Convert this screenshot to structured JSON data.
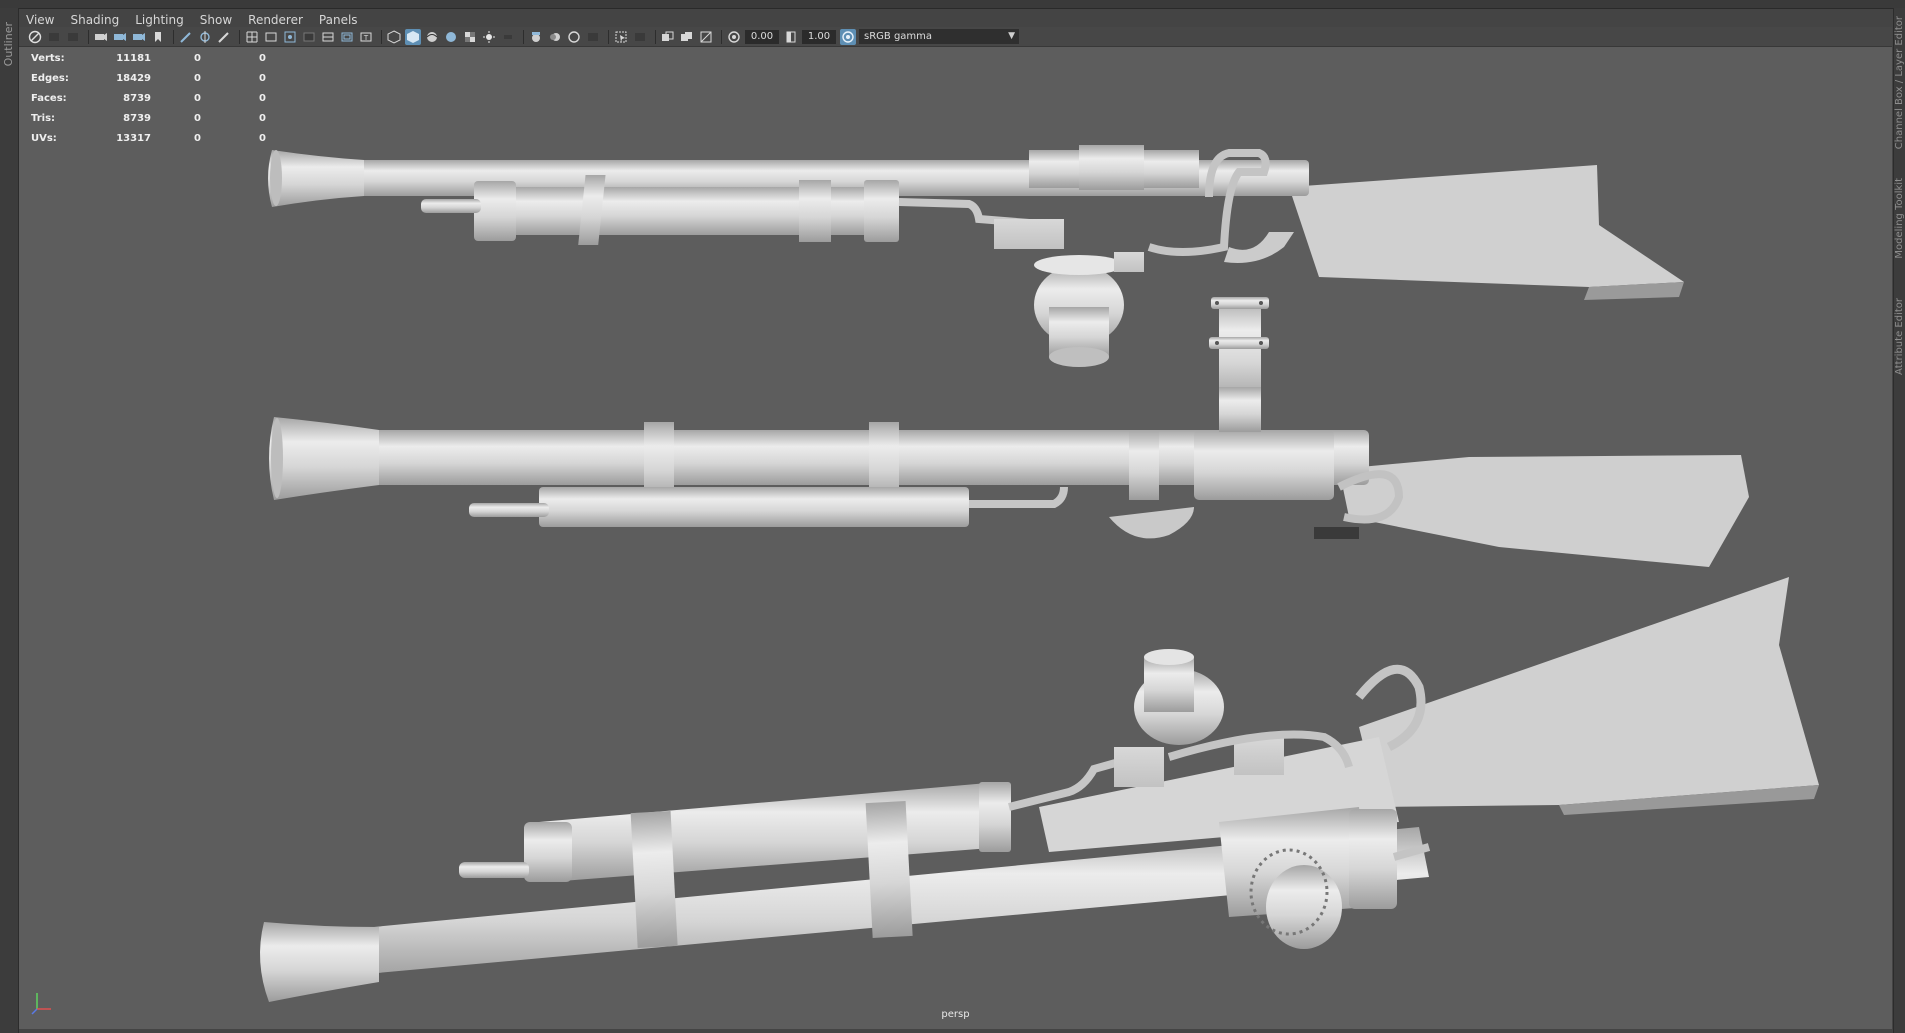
{
  "menu": [
    "View",
    "Shading",
    "Lighting",
    "Show",
    "Renderer",
    "Panels"
  ],
  "toolbar": {
    "exposure_value": "0.00",
    "gamma_value": "1.00",
    "color_space": "sRGB gamma"
  },
  "hud_stats": [
    {
      "label": "Verts:",
      "v1": "11181",
      "v2": "0",
      "v3": "0"
    },
    {
      "label": "Edges:",
      "v1": "18429",
      "v2": "0",
      "v3": "0"
    },
    {
      "label": "Faces:",
      "v1": "8739",
      "v2": "0",
      "v3": "0"
    },
    {
      "label": "Tris:",
      "v1": "8739",
      "v2": "0",
      "v3": "0"
    },
    {
      "label": "UVs:",
      "v1": "13317",
      "v2": "0",
      "v3": "0"
    }
  ],
  "camera": "persp",
  "side_panels": {
    "left": "Outliner",
    "right": [
      "Channel Box / Layer Editor",
      "Modeling Toolkit",
      "Attribute Editor"
    ]
  },
  "colors": {
    "viewport_bg": "#5d5d5d",
    "model_gray": "#d4d4d4",
    "active_tool": "#5e8fb4"
  }
}
